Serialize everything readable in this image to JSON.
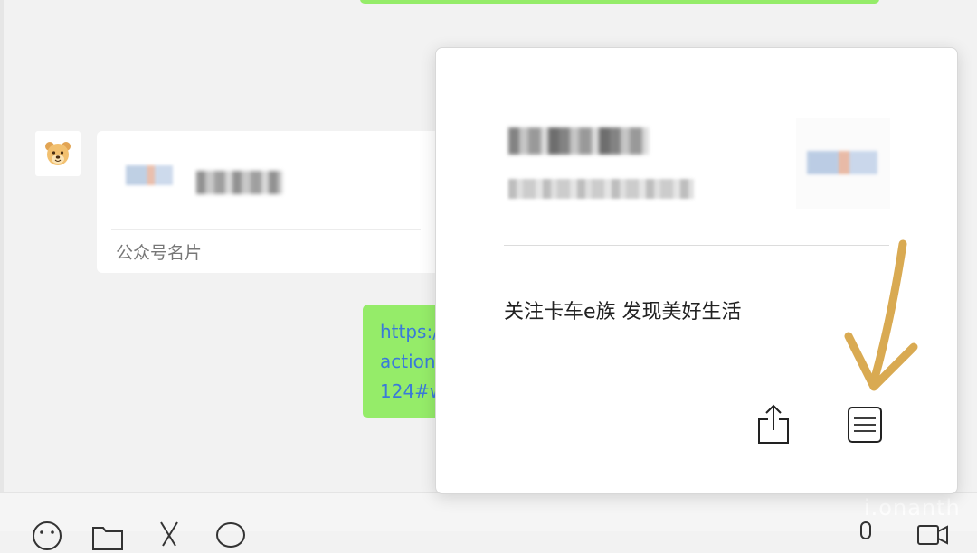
{
  "chat": {
    "card_message": {
      "label": "公众号名片"
    },
    "link_message": {
      "lines": [
        "https:/",
        "action",
        "124#w"
      ]
    }
  },
  "popup": {
    "description": "关注卡车e族 发现美好生活"
  },
  "watermark": "i.onanth",
  "colors": {
    "sent_bubble": "#95ec69",
    "link_text": "#3a7ad9",
    "annotation_arrow": "#d9aa52"
  },
  "icons": {
    "popup_actions": [
      "share-icon",
      "document-icon"
    ],
    "toolbar": [
      "emoji-icon",
      "folder-icon",
      "scissors-icon",
      "chat-bubble-icon",
      "microphone-icon",
      "video-icon"
    ]
  }
}
